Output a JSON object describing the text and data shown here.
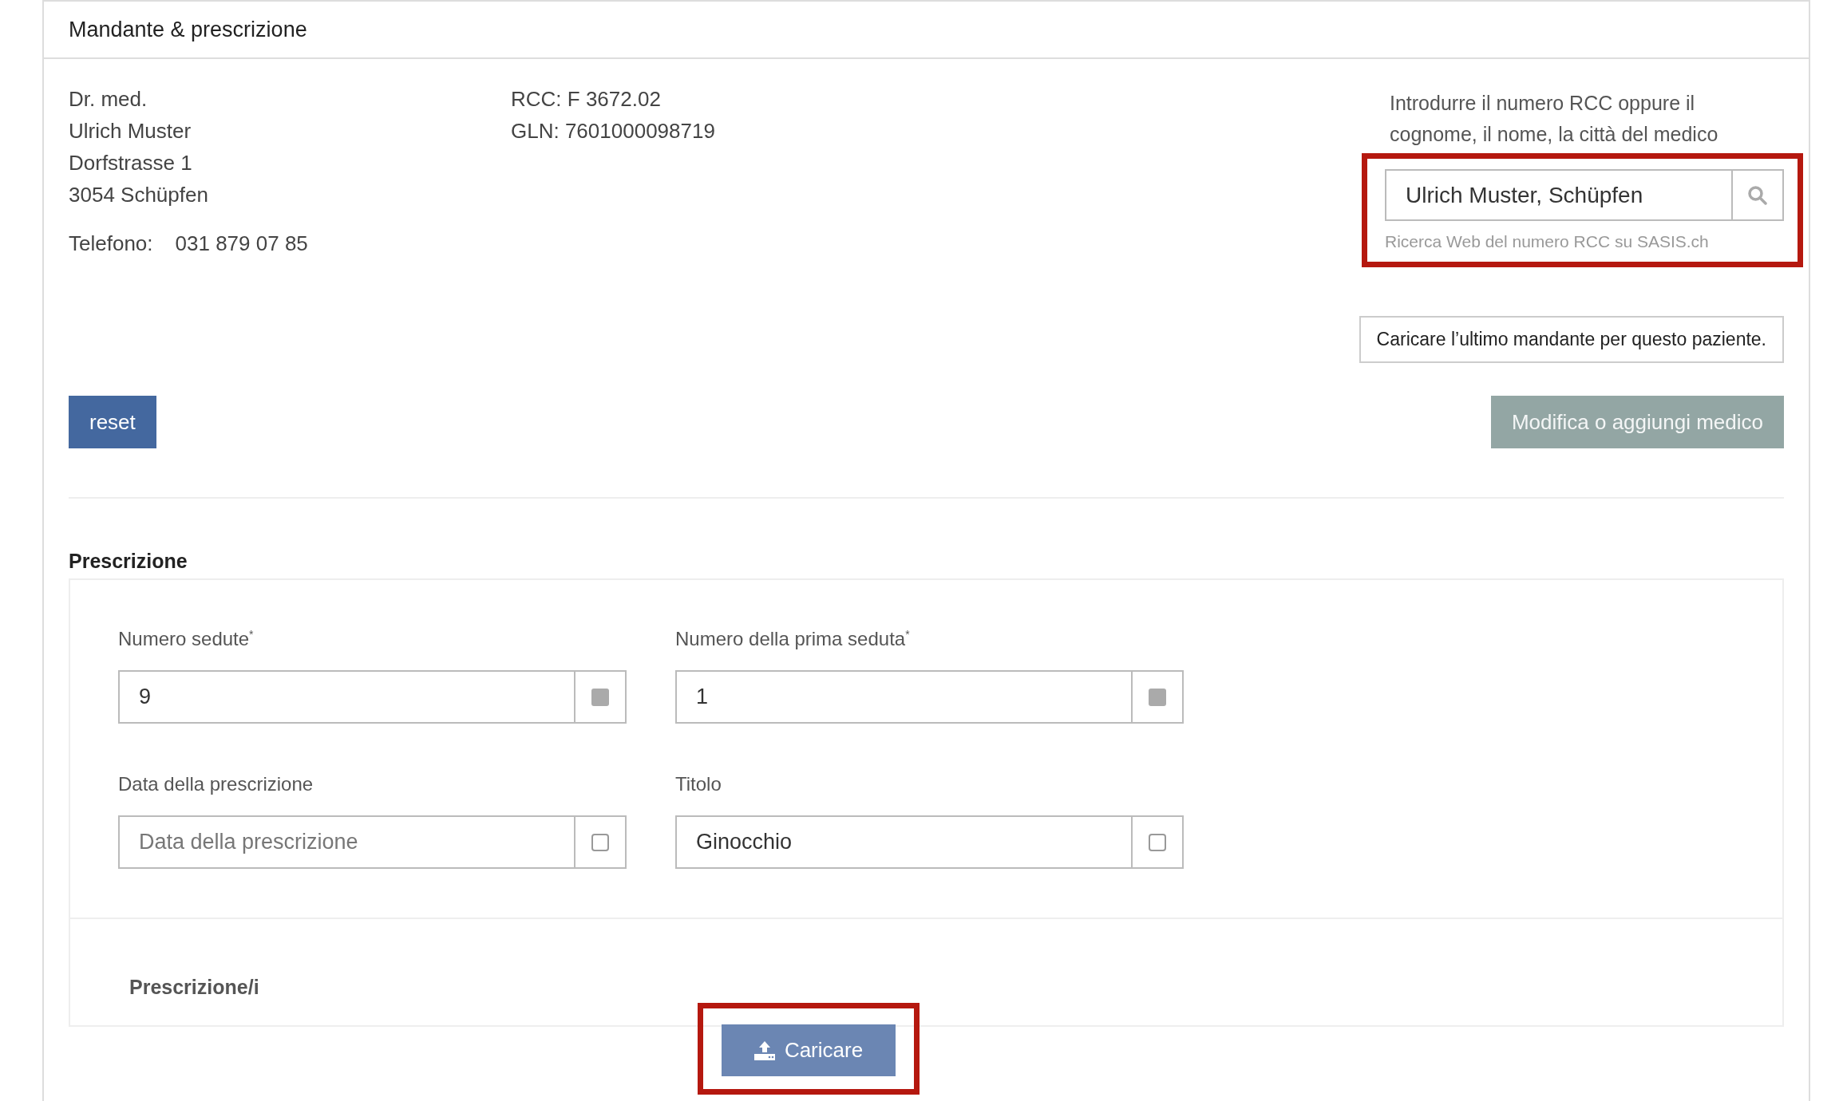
{
  "panel": {
    "title": "Mandante & prescrizione"
  },
  "doctor": {
    "lines": [
      "Dr. med.",
      "Ulrich Muster",
      "Dorfstrasse 1",
      "3054 Schüpfen"
    ],
    "phone_label": "Telefono:",
    "phone": "031 879 07 85"
  },
  "ids": [
    "RCC: F 3672.02",
    "GLN: 7601000098719"
  ],
  "search": {
    "hint": "Introdurre il numero RCC oppure il cognome, il nome, la città del medico",
    "value": "Ulrich Muster, Schüpfen",
    "help": "Ricerca Web del numero RCC su SASIS.ch",
    "highlighted": true
  },
  "load_last_button": "Caricare l’ultimo mandante per questo paziente.",
  "reset_button": {
    "label": "reset",
    "disabled": false
  },
  "edit_button": {
    "label": "Modifica o aggiungi medico",
    "disabled": true
  },
  "prescription": {
    "title": "Prescrizione",
    "fields": [
      {
        "label": "Numero sedute$^{*}$",
        "value": "9",
        "kind": "spinner"
      },
      {
        "label": "Numero della prima seduta$^{*}$",
        "value": "1",
        "kind": "spinner"
      },
      {
        "label": "Data della prescrizione",
        "placeholder": "Data della prescrizione",
        "kind": "picker"
      },
      {
        "label": "Titolo",
        "value": "Ginocchio",
        "kind": "picker"
      }
    ],
    "upload_label": "Prescrizione/i",
    "upload_button": {
      "label": "Caricare",
      "highlighted": true
    }
  }
}
